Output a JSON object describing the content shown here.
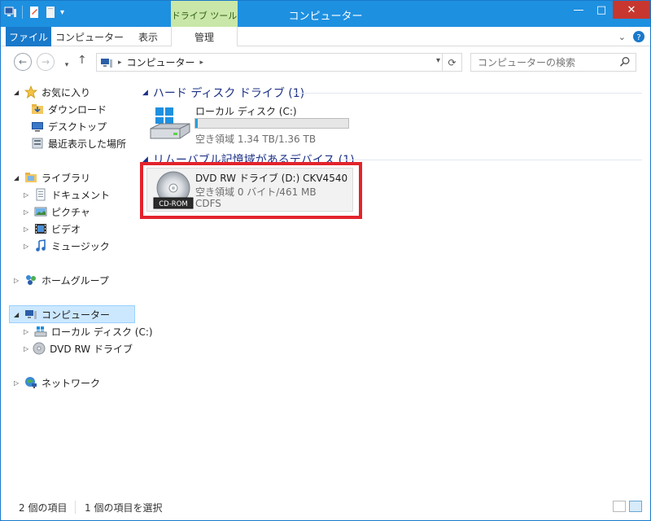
{
  "window": {
    "title": "コンピューター",
    "context_tab": "ドライブ ツール",
    "controls": [
      "—",
      "□",
      "✕"
    ]
  },
  "ribbon": {
    "tabs": [
      "ファイル",
      "コンピューター",
      "表示",
      "管理"
    ]
  },
  "address": {
    "path_root": "▸",
    "path_item": "コンピューター",
    "path_after": "▸",
    "dropdown": "▾",
    "refresh": "⟳"
  },
  "search": {
    "placeholder": "コンピューターの検索"
  },
  "nav": {
    "favorites": "お気に入り",
    "downloads": "ダウンロード",
    "desktop": "デスクトップ",
    "recent": "最近表示した場所",
    "libraries": "ライブラリ",
    "documents": "ドキュメント",
    "pictures": "ピクチャ",
    "videos": "ビデオ",
    "music": "ミュージック",
    "homegroup": "ホームグループ",
    "computer": "コンピューター",
    "local_disk": "ローカル ディスク (C:)",
    "dvd_drive": "DVD RW ドライブ (D",
    "network": "ネットワーク"
  },
  "content": {
    "hdd_group": "ハード ディスク ドライブ (1)",
    "removable_group": "リムーバブル記憶域があるデバイス (1)",
    "local_disk": {
      "name": "ローカル ディスク (C:)",
      "free": "空き領域 1.34 TB/1.36 TB",
      "used_fraction": 0.015
    },
    "dvd": {
      "name": "DVD RW ドライブ (D:) CKV4540",
      "free": "空き領域 0 バイト/461 MB",
      "fs": "CDFS",
      "label": "CD-ROM"
    }
  },
  "status": {
    "item_count": "2 個の項目",
    "selected": "1 個の項目を選択"
  },
  "colors": {
    "titlebar": "#1e90e0",
    "accent": "#1979ca",
    "highlight": "#e3232c",
    "progress": "#26a0da"
  }
}
